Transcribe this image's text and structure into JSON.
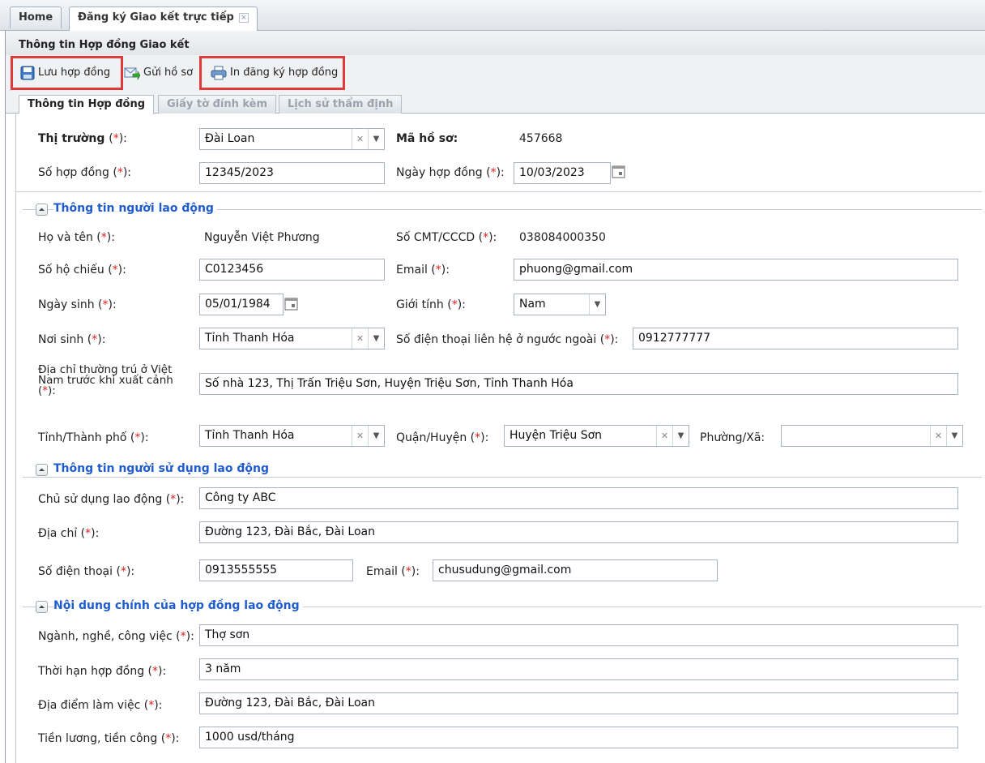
{
  "tabs": [
    {
      "label": "Home"
    },
    {
      "label": "Đăng ký Giao kết trực tiếp",
      "close": "×"
    }
  ],
  "panel_title": "Thông tin Hợp đồng Giao kết",
  "toolbar": {
    "save_label": "Lưu hợp đồng",
    "send_label": "Gửi hồ sơ",
    "print_label": "In đăng ký hợp đồng"
  },
  "inner_tabs": [
    {
      "label": "Thông tin Hợp đồng"
    },
    {
      "label": "Giấy tờ đính kèm"
    },
    {
      "label": "Lịch sử thẩm định"
    }
  ],
  "req": "*",
  "top": {
    "market_label": "Thị trường",
    "market_value": "Đài Loan",
    "file_code_label": "Mã hồ sơ:",
    "file_code_value": "457668",
    "contract_no_label": "Số hợp đồng",
    "contract_no_value": "12345/2023",
    "contract_date_label": "Ngày hợp đồng",
    "contract_date_value": "10/03/2023"
  },
  "worker": {
    "title": "Thông tin người lao động",
    "name_label": "Họ và tên",
    "name_value": "Nguyễn Việt Phương",
    "id_label": "Số CMT/CCCD",
    "id_value": "038084000350",
    "passport_label": "Số hộ chiếu",
    "passport_value": "C0123456",
    "email_label": "Email",
    "email_value": "phuong@gmail.com",
    "dob_label": "Ngày sinh",
    "dob_value": "05/01/1984",
    "gender_label": "Giới tính",
    "gender_value": "Nam",
    "birthplace_label": "Nơi sinh",
    "birthplace_value": "Tỉnh Thanh Hóa",
    "abroad_phone_label": "Số điện thoại liên hệ ở ngước ngoài",
    "abroad_phone_value": "0912777777",
    "address_label_1": "Địa chỉ thường trú ở Việt",
    "address_label_2": "Nam trước khi xuất cảnh",
    "address_value": "Số nhà 123, Thị Trấn Triệu Sơn, Huyện Triệu Sơn, Tỉnh Thanh Hóa",
    "province_label": "Tỉnh/Thành phố",
    "province_value": "Tỉnh Thanh Hóa",
    "district_label": "Quận/Huyện",
    "district_value": "Huyện Triệu Sơn",
    "ward_label": "Phường/Xã:",
    "ward_value": ""
  },
  "employer": {
    "title": "Thông tin người sử dụng lao động",
    "owner_label": "Chủ sử dụng lao động",
    "owner_value": "Công ty ABC",
    "address_label": "Địa chỉ",
    "address_value": "Đường 123, Đài Bắc, Đài Loan",
    "phone_label": "Số điện thoại",
    "phone_value": "0913555555",
    "email_label": "Email",
    "email_value": "chusudung@gmail.com"
  },
  "contract": {
    "title": "Nội dung chính của hợp đồng lao động",
    "job_label": "Ngành, nghề, công việc",
    "job_value": "Thợ sơn",
    "term_label": "Thời hạn hợp đồng",
    "term_value": "3 năm",
    "place_label": "Địa điểm làm việc",
    "place_value": "Đường 123, Đài Bắc, Đài Loan",
    "salary_label": "Tiền lương, tiền công",
    "salary_value": "1000 usd/tháng"
  },
  "colors": {
    "accent_blue": "#1f5bd1",
    "required_red": "#e02020",
    "highlight_red": "#e03a3a"
  }
}
